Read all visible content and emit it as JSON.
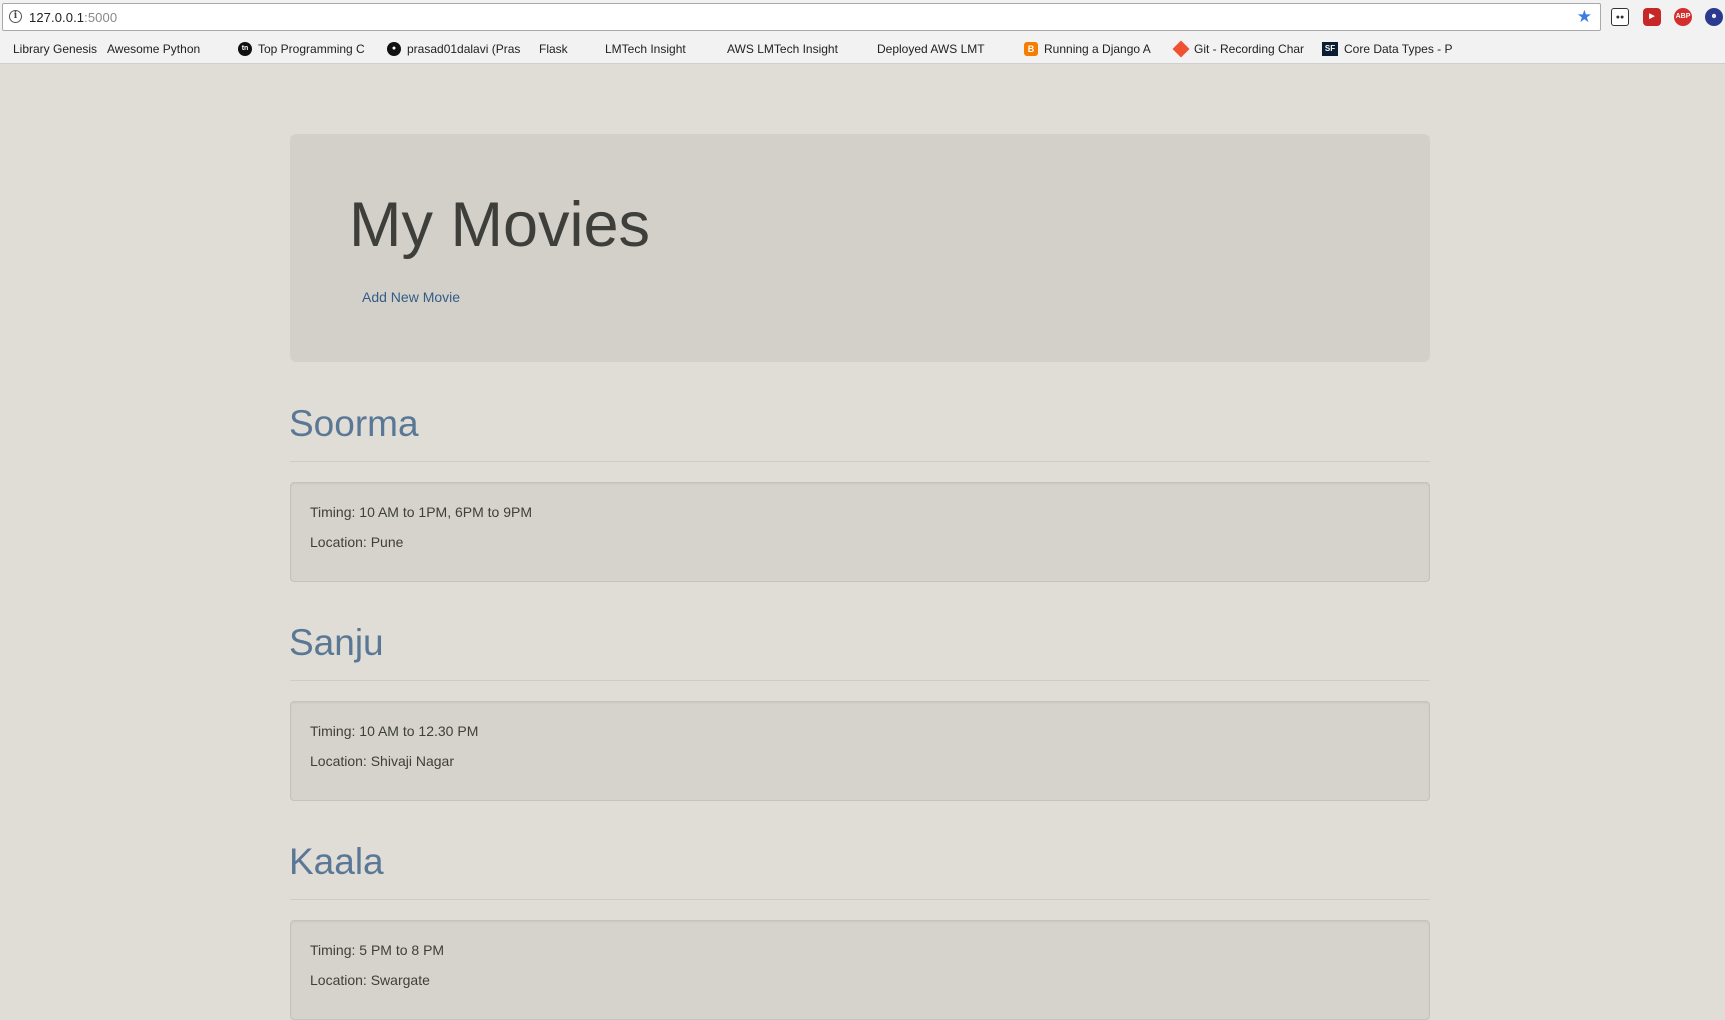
{
  "browser": {
    "url_host": "127.0.0.1",
    "url_port": ":5000",
    "star_icon": "bookmark-star-icon",
    "bookmarks": [
      {
        "label": "Library Genesis",
        "icon": "none"
      },
      {
        "label": "Awesome Python",
        "icon": "page-icon"
      },
      {
        "label": "Top Programming C",
        "icon": "round-icon"
      },
      {
        "label": "prasad01dalavi (Pras",
        "icon": "github-icon"
      },
      {
        "label": "Flask",
        "icon": "page-icon"
      },
      {
        "label": "LMTech Insight",
        "icon": "page-icon"
      },
      {
        "label": "AWS LMTech Insight",
        "icon": "page-icon"
      },
      {
        "label": "Deployed AWS LMT",
        "icon": "page-icon"
      },
      {
        "label": "Running a Django A",
        "icon": "blogger-icon"
      },
      {
        "label": "Git - Recording Char",
        "icon": "git-icon"
      },
      {
        "label": "Core Data Types - P",
        "icon": "sf-icon"
      }
    ],
    "extension_labels": {
      "abp": "ABP"
    }
  },
  "header": {
    "title": "My Movies",
    "add_link": "Add New Movie"
  },
  "labels": {
    "timing": "Timing: ",
    "location": "Location: "
  },
  "movies": [
    {
      "name": "Soorma",
      "timing": "10 AM to 1PM, 6PM to 9PM",
      "location": "Pune"
    },
    {
      "name": "Sanju",
      "timing": "10 AM to 12.30 PM",
      "location": "Shivaji Nagar"
    },
    {
      "name": "Kaala",
      "timing": "5 PM to 8 PM",
      "location": "Swargate"
    }
  ]
}
